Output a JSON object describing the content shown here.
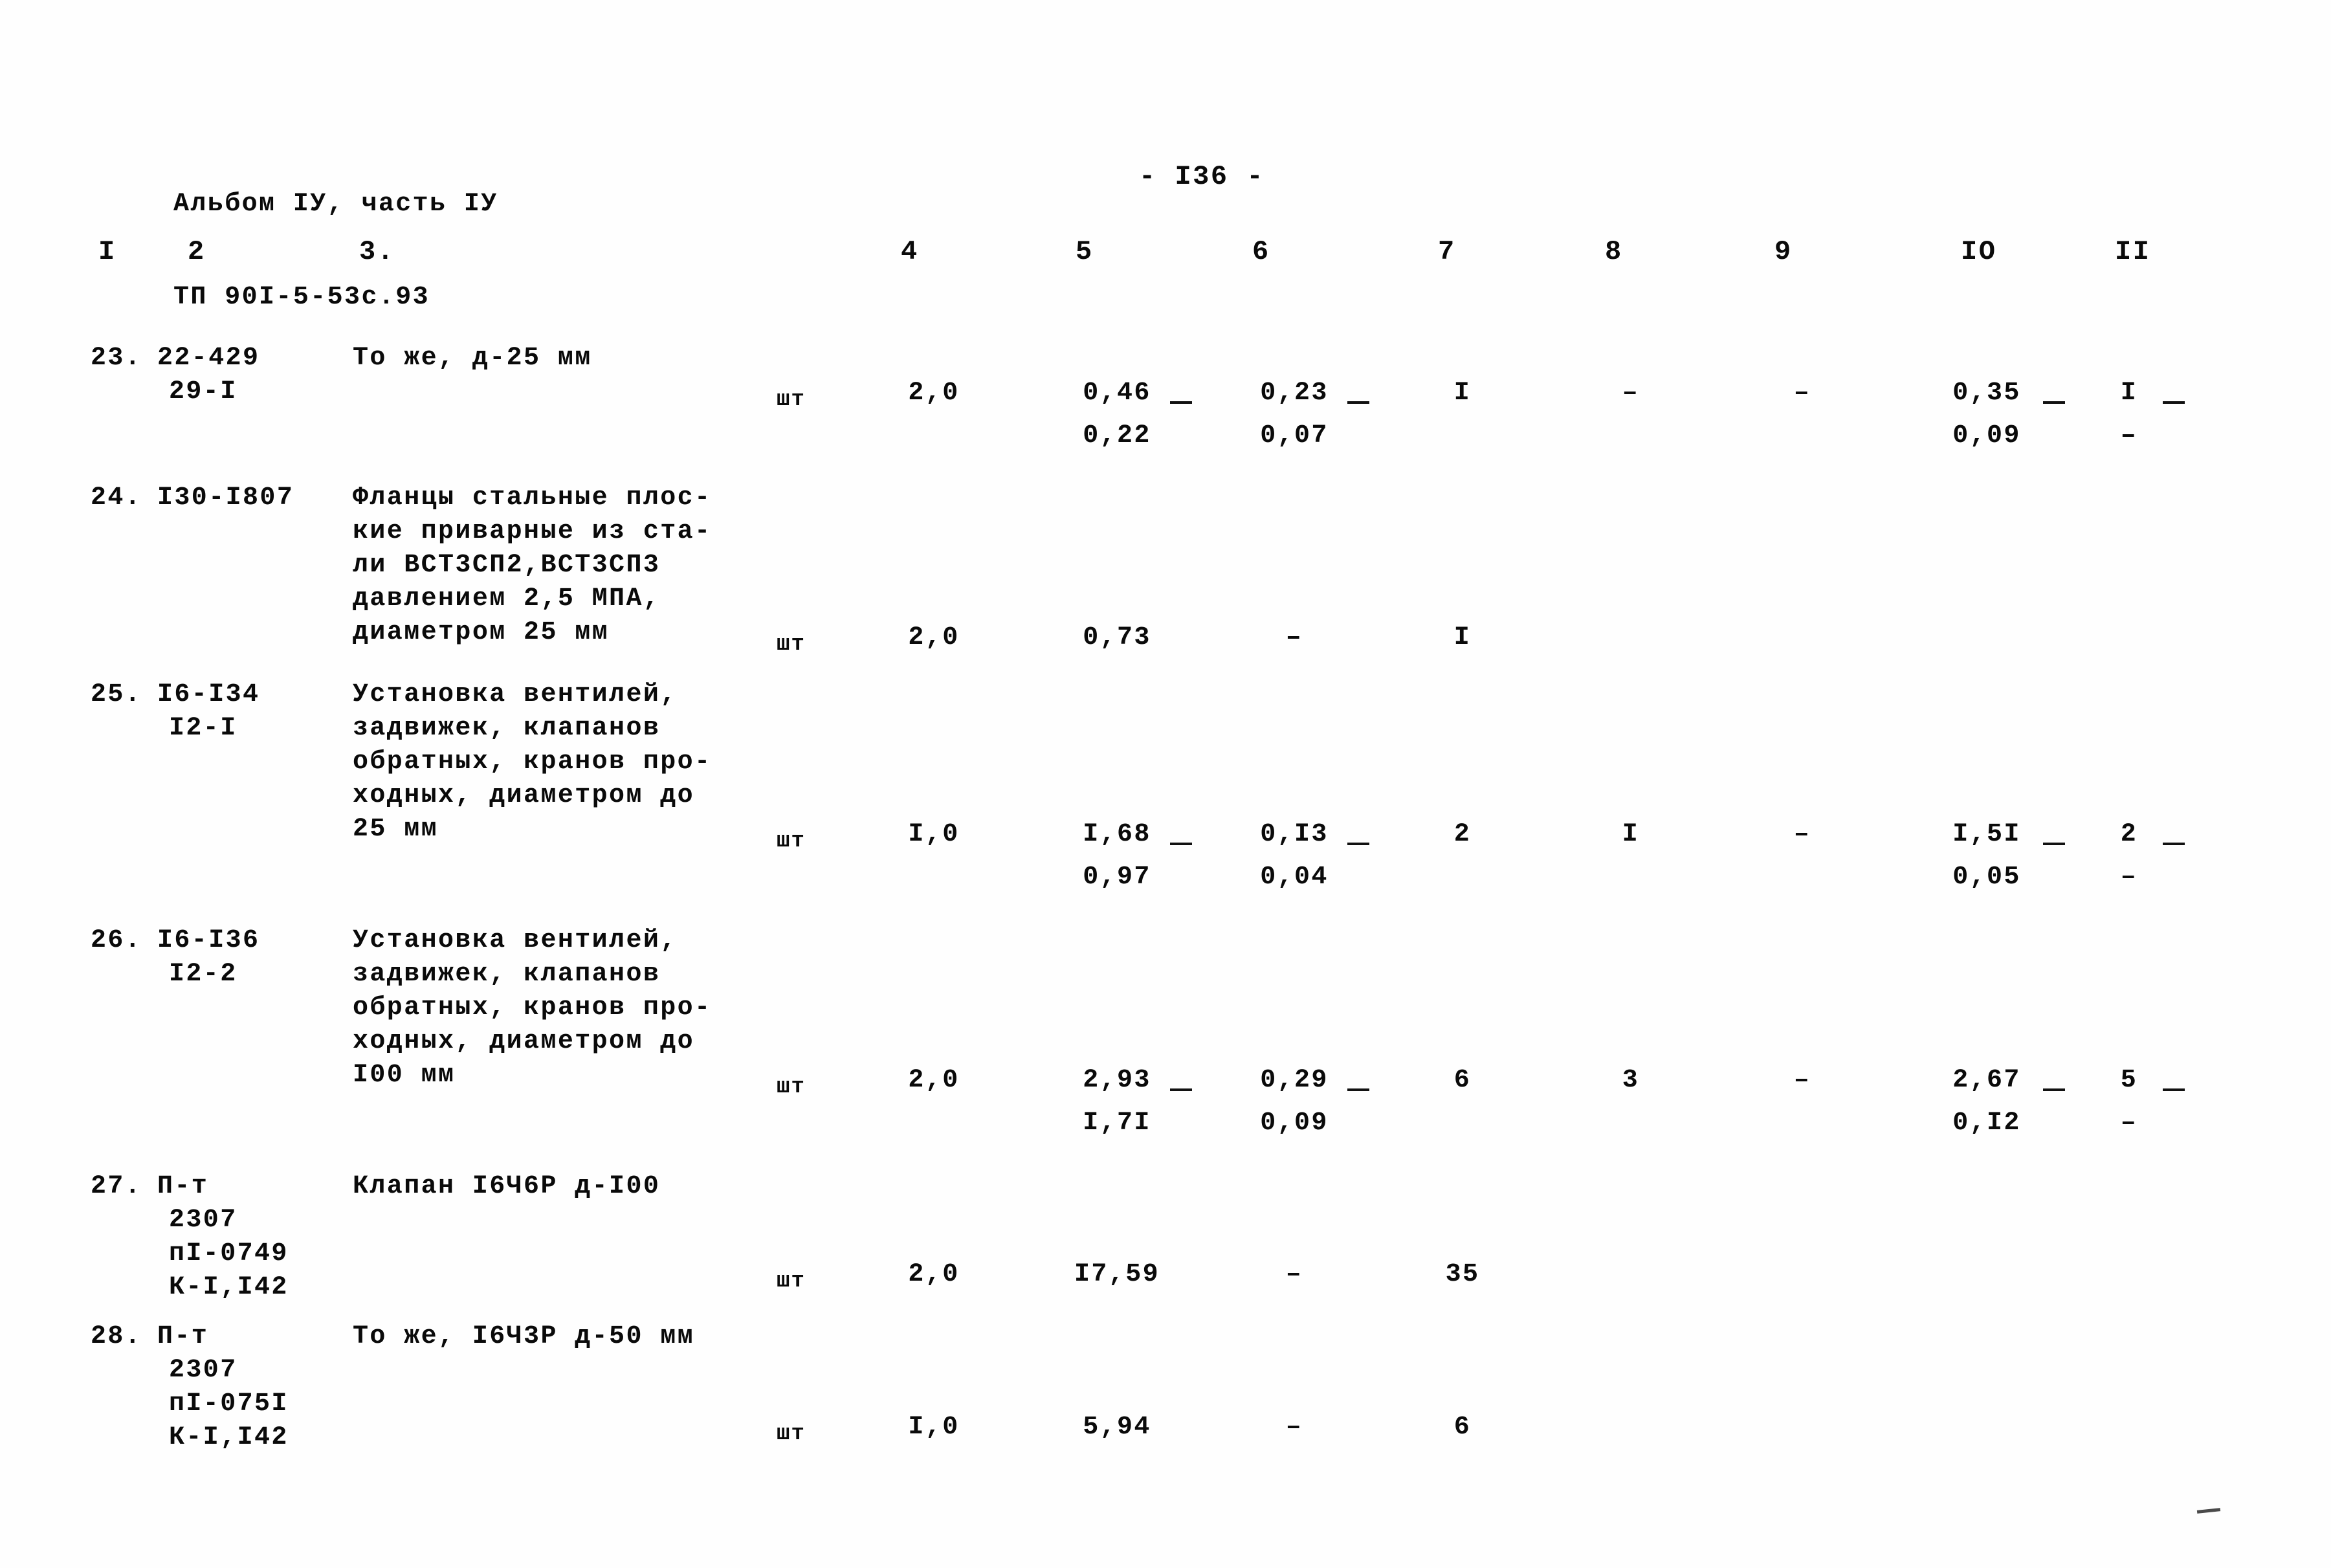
{
  "header": {
    "line1": "Альбом IУ, часть IУ",
    "line2": "ТП 90I-5-53с.93",
    "page_number": "- I36 -"
  },
  "table": {
    "column_headers": [
      "I",
      "2",
      "3.",
      "4",
      "5",
      "6",
      "7",
      "8",
      "9",
      "IO",
      "II"
    ],
    "rows": [
      {
        "num": "23.",
        "code_line1": "22-429",
        "code_line2": "29-I",
        "desc_lines": [
          "То же, д-25 мм"
        ],
        "unit": "шт",
        "qty": "2,0",
        "c5_top": "0,46",
        "c5_bottom": "0,22",
        "c6_top": "0,23",
        "c6_bottom": "0,07",
        "c7": "I",
        "c8": "–",
        "c9": "–",
        "c10_top": "0,35",
        "c10_bottom": "0,09",
        "c11_top": "I",
        "c11_bottom": "–"
      },
      {
        "num": "24.",
        "code_line1": "I30-I807",
        "code_line2": "",
        "desc_lines": [
          "Фланцы стальные плос-",
          "кие приварные из ста-",
          "ли ВСТ3СП2,ВСТ3СП3",
          "давлением 2,5 МПА,",
          "диаметром 25 мм"
        ],
        "unit": "шт",
        "qty": "2,0",
        "c5_top": "0,73",
        "c5_bottom": "",
        "c6_top": "–",
        "c6_bottom": "",
        "c7": "I",
        "c8": "",
        "c9": "",
        "c10_top": "",
        "c10_bottom": "",
        "c11_top": "",
        "c11_bottom": ""
      },
      {
        "num": "25.",
        "code_line1": "I6-I34",
        "code_line2": "I2-I",
        "desc_lines": [
          "Установка вентилей,",
          "задвижек, клапанов",
          "обратных, кранов про-",
          "ходных, диаметром до",
          "25 мм"
        ],
        "unit": "шт",
        "qty": "I,0",
        "c5_top": "I,68",
        "c5_bottom": "0,97",
        "c6_top": "0,I3",
        "c6_bottom": "0,04",
        "c7": "2",
        "c8": "I",
        "c9": "–",
        "c10_top": "I,5I",
        "c10_bottom": "0,05",
        "c11_top": "2",
        "c11_bottom": "–"
      },
      {
        "num": "26.",
        "code_line1": "I6-I36",
        "code_line2": "I2-2",
        "desc_lines": [
          "Установка вентилей,",
          "задвижек, клапанов",
          "обратных, кранов про-",
          "ходных, диаметром до",
          "I00 мм"
        ],
        "unit": "шт",
        "qty": "2,0",
        "c5_top": "2,93",
        "c5_bottom": "I,7I",
        "c6_top": "0,29",
        "c6_bottom": "0,09",
        "c7": "6",
        "c8": "3",
        "c9": "–",
        "c10_top": "2,67",
        "c10_bottom": "0,I2",
        "c11_top": "5",
        "c11_bottom": "–"
      },
      {
        "num": "27.",
        "code_line1": "П-т",
        "code_line2": "2307",
        "code_line3": "пI-0749",
        "code_line4": "К-I,I42",
        "desc_lines": [
          "Клапан I6Ч6Р д-I00"
        ],
        "unit": "шт",
        "qty": "2,0",
        "c5_top": "I7,59",
        "c5_bottom": "",
        "c6_top": "–",
        "c6_bottom": "",
        "c7": "35",
        "c8": "",
        "c9": "",
        "c10_top": "",
        "c10_bottom": "",
        "c11_top": "",
        "c11_bottom": ""
      },
      {
        "num": "28.",
        "code_line1": "П-т",
        "code_line2": "2307",
        "code_line3": "пI-075I",
        "code_line4": "К-I,I42",
        "desc_lines": [
          "То же, I6Ч3Р д-50 мм"
        ],
        "unit": "шт",
        "qty": "I,0",
        "c5_top": "5,94",
        "c5_bottom": "",
        "c6_top": "–",
        "c6_bottom": "",
        "c7": "6",
        "c8": "",
        "c9": "",
        "c10_top": "",
        "c10_bottom": "",
        "c11_top": "",
        "c11_bottom": ""
      }
    ]
  }
}
